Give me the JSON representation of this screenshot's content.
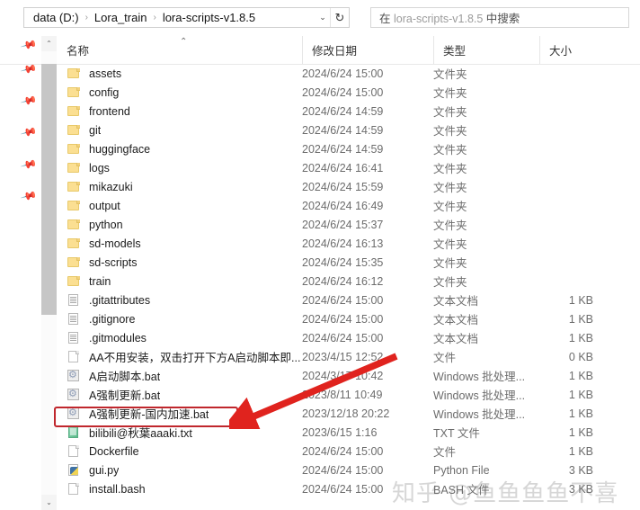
{
  "window": {
    "address": {
      "crumbs": [
        "data (D:)",
        "Lora_train",
        "lora-scripts-v1.8.5"
      ],
      "separator": "›",
      "dropdown_icon": "⌄",
      "refresh_icon": "↻"
    },
    "search": {
      "prefix": "在 ",
      "scope": "lora-scripts-v1.8.5",
      "suffix": " 中搜索"
    }
  },
  "columns": {
    "name": "名称",
    "date_modified": "修改日期",
    "type": "类型",
    "size": "大小",
    "sort_caret": "⌃"
  },
  "scrollbar": {
    "up_arrow": "⌃",
    "down_arrow": "⌄"
  },
  "pin_icon": "📌",
  "pins_count": 6,
  "files": [
    {
      "name": "assets",
      "icon": "folder",
      "date": "2024/6/24 15:00",
      "type": "文件夹",
      "size": ""
    },
    {
      "name": "config",
      "icon": "folder",
      "date": "2024/6/24 15:00",
      "type": "文件夹",
      "size": ""
    },
    {
      "name": "frontend",
      "icon": "folder",
      "date": "2024/6/24 14:59",
      "type": "文件夹",
      "size": ""
    },
    {
      "name": "git",
      "icon": "folder",
      "date": "2024/6/24 14:59",
      "type": "文件夹",
      "size": ""
    },
    {
      "name": "huggingface",
      "icon": "folder",
      "date": "2024/6/24 14:59",
      "type": "文件夹",
      "size": ""
    },
    {
      "name": "logs",
      "icon": "folder",
      "date": "2024/6/24 16:41",
      "type": "文件夹",
      "size": ""
    },
    {
      "name": "mikazuki",
      "icon": "folder",
      "date": "2024/6/24 15:59",
      "type": "文件夹",
      "size": ""
    },
    {
      "name": "output",
      "icon": "folder",
      "date": "2024/6/24 16:49",
      "type": "文件夹",
      "size": ""
    },
    {
      "name": "python",
      "icon": "folder",
      "date": "2024/6/24 15:37",
      "type": "文件夹",
      "size": ""
    },
    {
      "name": "sd-models",
      "icon": "folder",
      "date": "2024/6/24 16:13",
      "type": "文件夹",
      "size": ""
    },
    {
      "name": "sd-scripts",
      "icon": "folder",
      "date": "2024/6/24 15:35",
      "type": "文件夹",
      "size": ""
    },
    {
      "name": "train",
      "icon": "folder",
      "date": "2024/6/24 16:12",
      "type": "文件夹",
      "size": ""
    },
    {
      "name": ".gitattributes",
      "icon": "textdoc",
      "date": "2024/6/24 15:00",
      "type": "文本文档",
      "size": "1 KB"
    },
    {
      "name": ".gitignore",
      "icon": "textdoc",
      "date": "2024/6/24 15:00",
      "type": "文本文档",
      "size": "1 KB"
    },
    {
      "name": ".gitmodules",
      "icon": "textdoc",
      "date": "2024/6/24 15:00",
      "type": "文本文档",
      "size": "1 KB"
    },
    {
      "name": "AA不用安装，双击打开下方A启动脚本即...",
      "icon": "blank",
      "date": "2023/4/15 12:52",
      "type": "文件",
      "size": "0 KB"
    },
    {
      "name": "A启动脚本.bat",
      "icon": "bat",
      "date": "2024/3/17 10:42",
      "type": "Windows 批处理...",
      "size": "1 KB"
    },
    {
      "name": "A强制更新.bat",
      "icon": "bat",
      "date": "2023/8/11 10:49",
      "type": "Windows 批处理...",
      "size": "1 KB"
    },
    {
      "name": "A强制更新-国内加速.bat",
      "icon": "bat",
      "date": "2023/12/18 20:22",
      "type": "Windows 批处理...",
      "size": "1 KB",
      "highlighted": true
    },
    {
      "name": "bilibili@秋葉aaaki.txt",
      "icon": "greentxt",
      "date": "2023/6/15 1:16",
      "type": "TXT 文件",
      "size": "1 KB"
    },
    {
      "name": "Dockerfile",
      "icon": "blank",
      "date": "2024/6/24 15:00",
      "type": "文件",
      "size": "1 KB"
    },
    {
      "name": "gui.py",
      "icon": "py",
      "date": "2024/6/24 15:00",
      "type": "Python File",
      "size": "3 KB"
    },
    {
      "name": "install.bash",
      "icon": "blank",
      "date": "2024/6/24 15:00",
      "type": "BASH 文件",
      "size": "3 KB"
    }
  ],
  "annotations": {
    "highlight_color": "#c0272d",
    "arrow_color": "#e0231e",
    "highlighted_file": "A强制更新-国内加速.bat"
  },
  "watermark": "知乎 @鱼鱼鱼鱼不喜"
}
